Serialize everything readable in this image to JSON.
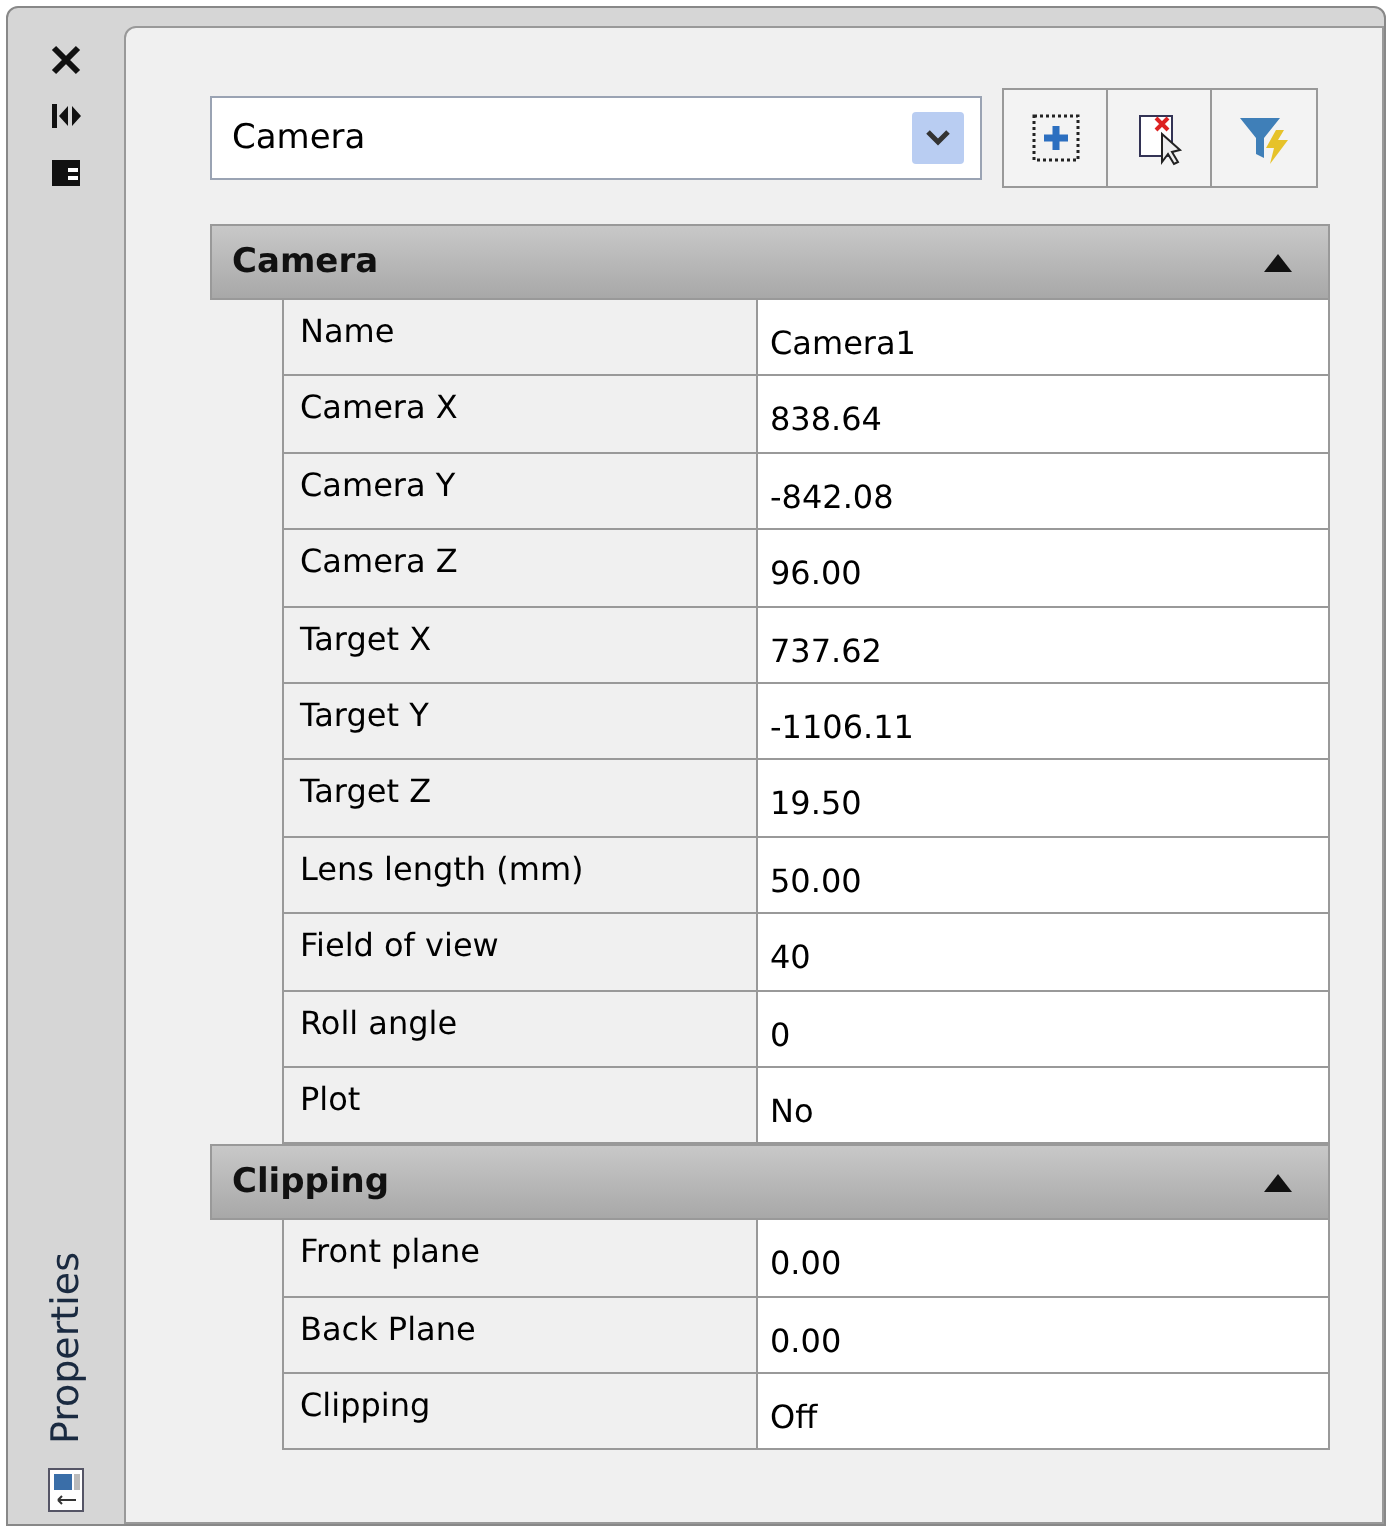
{
  "side_bar": {
    "title": "Properties"
  },
  "object_select": {
    "value": "Camera"
  },
  "sections": [
    {
      "title": "Camera",
      "expanded": true,
      "rows": [
        {
          "label": "Name",
          "value": "Camera1"
        },
        {
          "label": "Camera X",
          "value": "838.64"
        },
        {
          "label": "Camera Y",
          "value": "-842.08"
        },
        {
          "label": "Camera Z",
          "value": "96.00"
        },
        {
          "label": "Target X",
          "value": "737.62"
        },
        {
          "label": "Target Y",
          "value": "-1106.11"
        },
        {
          "label": "Target Z",
          "value": "19.50"
        },
        {
          "label": "Lens length (mm)",
          "value": "50.00"
        },
        {
          "label": "Field of view",
          "value": "40"
        },
        {
          "label": "Roll angle",
          "value": "0"
        },
        {
          "label": "Plot",
          "value": "No"
        }
      ]
    },
    {
      "title": "Clipping",
      "expanded": true,
      "rows": [
        {
          "label": "Front plane",
          "value": "0.00"
        },
        {
          "label": "Back Plane",
          "value": "0.00"
        },
        {
          "label": "Clipping",
          "value": "Off"
        }
      ]
    }
  ]
}
